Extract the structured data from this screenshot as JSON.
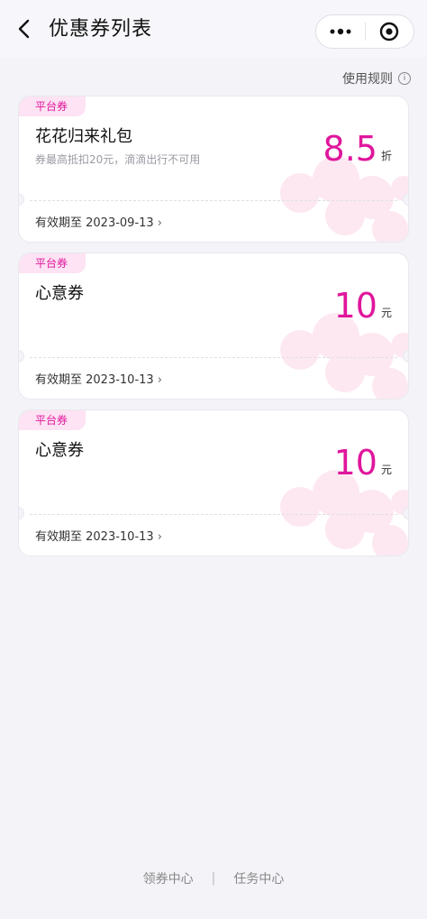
{
  "header": {
    "title": "优惠券列表"
  },
  "rules_label": "使用规则",
  "coupons": [
    {
      "tag": "平台券",
      "title": "花花归来礼包",
      "desc": "券最高抵扣20元，滴滴出行不可用",
      "amount": "8.5",
      "unit": "折",
      "expire": "有效期至 2023-09-13"
    },
    {
      "tag": "平台券",
      "title": "心意券",
      "desc": "",
      "amount": "10",
      "unit": "元",
      "expire": "有效期至 2023-10-13"
    },
    {
      "tag": "平台券",
      "title": "心意券",
      "desc": "",
      "amount": "10",
      "unit": "元",
      "expire": "有效期至 2023-10-13"
    }
  ],
  "footer": {
    "left": "领券中心",
    "divider": "|",
    "right": "任务中心"
  },
  "colors": {
    "accent": "#e0169c",
    "tag_bg": "#fde3f3",
    "page_bg": "#f3f3f8"
  },
  "icons": {
    "back": "chevron-left-icon",
    "more": "more-dots-icon",
    "target": "target-icon",
    "info": "info-icon"
  }
}
